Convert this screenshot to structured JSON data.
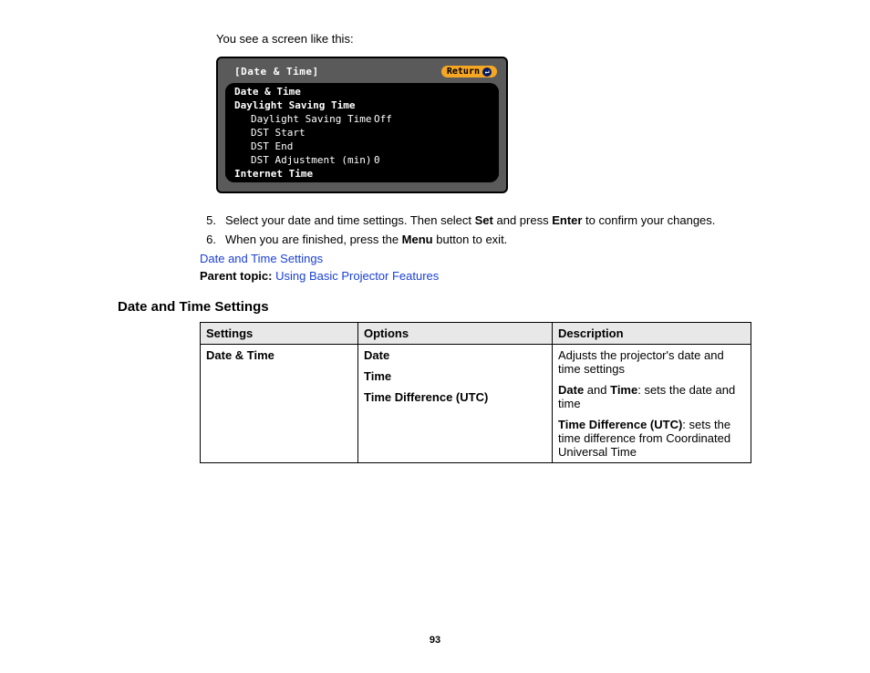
{
  "intro": "You see a screen like this:",
  "menu": {
    "title": "[Date & Time]",
    "return_label": "Return",
    "items": {
      "date_time": "Date & Time",
      "dst_section": "Daylight Saving Time",
      "dst_toggle_label": "Daylight Saving Time",
      "dst_toggle_value": "Off",
      "dst_start": "DST Start",
      "dst_end": "DST End",
      "dst_adj_label": "DST Adjustment (min)",
      "dst_adj_value": "0",
      "internet_time": "Internet Time"
    }
  },
  "steps": [
    {
      "num": "5.",
      "pre": "Select your date and time settings. Then select ",
      "b1": "Set",
      "mid": " and press ",
      "b2": "Enter",
      "post": " to confirm your changes."
    },
    {
      "num": "6.",
      "pre": "When you are finished, press the ",
      "b1": "Menu",
      "mid": " button to exit.",
      "b2": "",
      "post": ""
    }
  ],
  "link1": "Date and Time Settings",
  "parent_topic_label": "Parent topic:",
  "parent_topic_link": "Using Basic Projector Features",
  "heading": "Date and Time Settings",
  "table": {
    "h1": "Settings",
    "h2": "Options",
    "h3": "Description",
    "row1": {
      "setting": "Date & Time",
      "opt1": "Date",
      "opt2": "Time",
      "opt3": "Time Difference (UTC)",
      "desc1": "Adjusts the projector's date and time settings",
      "desc2_b1": "Date",
      "desc2_mid": " and ",
      "desc2_b2": "Time",
      "desc2_post": ": sets the date and time",
      "desc3_b": "Time Difference (UTC)",
      "desc3_post": ": sets the time difference from Coordinated Universal Time"
    }
  },
  "page_number": "93"
}
